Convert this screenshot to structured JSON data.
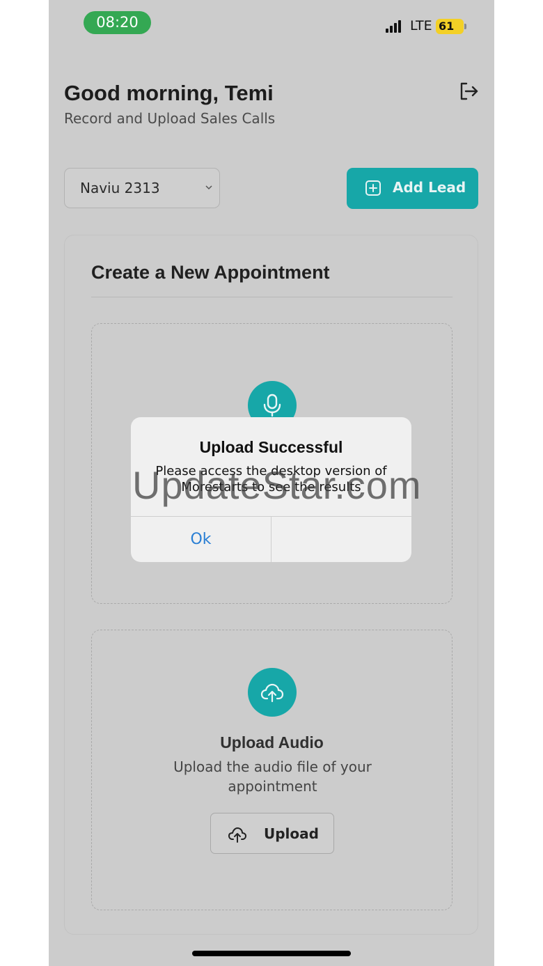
{
  "status_bar": {
    "time": "08:20",
    "network": "LTE",
    "battery": "61"
  },
  "header": {
    "greeting": "Good morning, Temi",
    "subtitle": "Record and Upload Sales Calls"
  },
  "lead_select": {
    "value": "Naviu 2313"
  },
  "add_lead": {
    "label": "Add Lead"
  },
  "card": {
    "title": "Create a New Appointment",
    "upload_zone": {
      "title": "Upload Audio",
      "description": "Upload the audio file of your appointment",
      "button_label": "Upload"
    }
  },
  "alert": {
    "title": "Upload Successful",
    "message": "Please access the desktop version of Morestarts to see the results",
    "ok_label": "Ok"
  },
  "watermark": "UpdateStar.com",
  "colors": {
    "accent": "#17a7a8",
    "link_blue": "#2a7fd4",
    "time_pill": "#34a853",
    "battery": "#f3d026"
  },
  "icons": [
    "microphone-icon",
    "cloud-upload-icon",
    "logout-icon",
    "plus-square-icon",
    "chevron-down-icon"
  ]
}
